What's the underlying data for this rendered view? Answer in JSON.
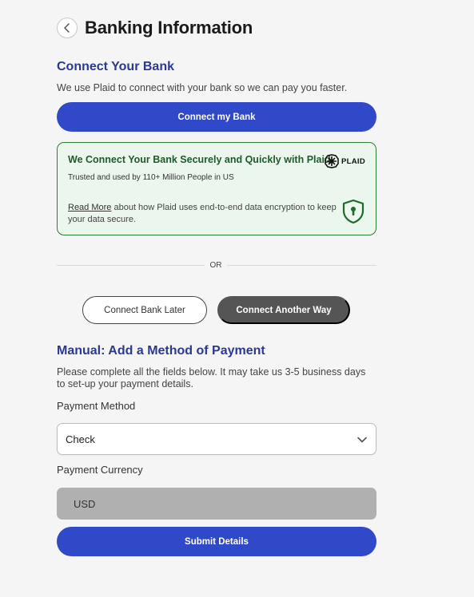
{
  "header": {
    "title": "Banking Information",
    "back_icon": "chevron-left-icon"
  },
  "connect": {
    "title": "Connect Your Bank",
    "description": "We use Plaid to connect with your bank so we can pay you faster.",
    "button_label": "Connect my Bank"
  },
  "plaid": {
    "title": "We Connect Your Bank Securely and Quickly with Plaid",
    "logo_text": "PLAID",
    "subtitle": "Trusted and used by 110+ Million People in US",
    "read_more": "Read More",
    "read_more_rest": " about how Plaid uses end-to-end data encryption to keep your data secure.",
    "shield_icon": "shield-lock-icon"
  },
  "divider": {
    "text": "OR"
  },
  "alt_buttons": {
    "later": "Connect Bank Later",
    "another": "Connect Another Way"
  },
  "manual": {
    "title": "Manual: Add a Method of Payment",
    "description": "Please complete all the fields below. It may take us 3-5 business days to set-up your payment details.",
    "payment_method_label": "Payment Method",
    "payment_method_value": "Check",
    "payment_currency_label": "Payment Currency",
    "payment_currency_value": "USD",
    "submit_label": "Submit Details"
  },
  "colors": {
    "primary": "#3049c9",
    "heading": "#2b3990",
    "plaid_border": "#2e7d32",
    "plaid_bg": "#ebf6ed",
    "dark_button": "#555555"
  }
}
